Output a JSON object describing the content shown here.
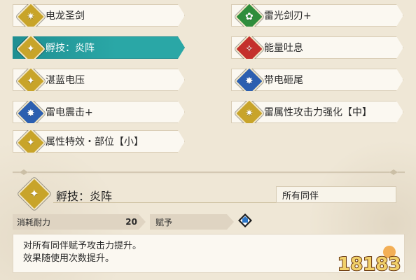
{
  "skills_left": [
    {
      "label": "电龙圣剑",
      "icon": "sword-emblem-icon",
      "color": "#c8a42a"
    },
    {
      "label": "孵技：炎阵",
      "icon": "trainee-figure-icon",
      "color": "#c8a42a",
      "selected": true
    },
    {
      "label": "湛蓝电压",
      "icon": "trainee-figure-icon",
      "color": "#c8a42a"
    },
    {
      "label": "雷电震击+",
      "icon": "burst-figure-icon",
      "color": "#2c5fb0"
    },
    {
      "label": "属性特效・部位【小】",
      "icon": "trainee-figure-icon",
      "color": "#c8a42a"
    }
  ],
  "skills_right": [
    {
      "label": "雷光剑刃+",
      "icon": "leaf-blade-icon",
      "color": "#2f8d3c"
    },
    {
      "label": "能量吐息",
      "icon": "figure-up-icon",
      "color": "#c4302c"
    },
    {
      "label": "带电砸尾",
      "icon": "burst-figure-icon",
      "color": "#2c5fb0"
    },
    {
      "label": "雷属性攻击力强化【中】",
      "icon": "sword-emblem-icon",
      "color": "#c8a42a"
    }
  ],
  "detail": {
    "title": "孵技：炎阵",
    "icon": "trainee-figure-icon",
    "icon_color": "#c8a42a",
    "recipient": "所有同伴",
    "stamina_label": "消耗耐力",
    "stamina_value": "20",
    "grant_label": "赋予",
    "grant_icon": "blue-tile-icon",
    "description_line1": "对所有同伴赋予攻击力提升。",
    "description_line2": "效果随使用次数提升。"
  },
  "watermark": {
    "text": "18183"
  }
}
